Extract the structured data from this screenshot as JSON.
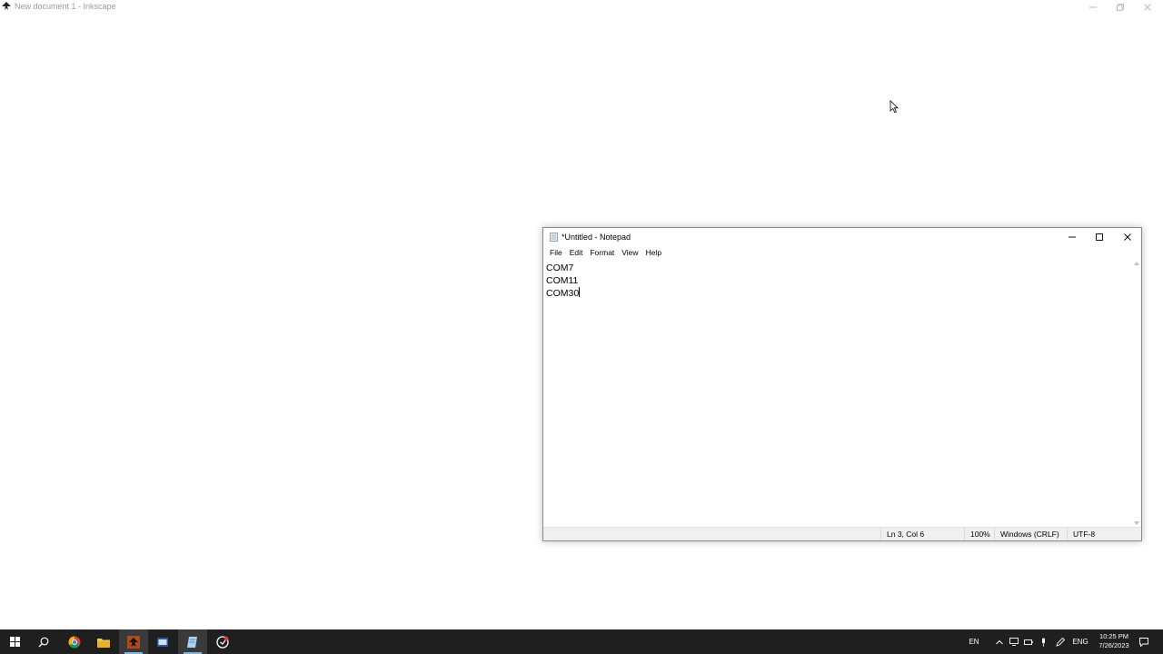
{
  "background_window": {
    "title": "New document 1 - Inkscape"
  },
  "notepad": {
    "title": "*Untitled - Notepad",
    "menu": [
      "File",
      "Edit",
      "Format",
      "View",
      "Help"
    ],
    "lines": [
      "COM7",
      "COM11",
      "COM30"
    ],
    "status": {
      "position": "Ln 3, Col 6",
      "zoom": "100%",
      "line_endings": "Windows (CRLF)",
      "encoding": "UTF-8"
    }
  },
  "taskbar": {
    "pinned": [
      {
        "name": "chrome",
        "active": false
      },
      {
        "name": "file-explorer",
        "active": false
      },
      {
        "name": "inkscape",
        "active": true
      },
      {
        "name": "app-4",
        "active": false
      },
      {
        "name": "notepad",
        "active": true
      },
      {
        "name": "app-6",
        "active": false
      }
    ],
    "tray": {
      "keyboard_indicator": "EN",
      "language": "ENG",
      "time": "10:25 PM",
      "date": "7/26/2023"
    }
  },
  "colors": {
    "taskbar_bg": "#1f1f1f",
    "accent": "#76b9ed"
  }
}
